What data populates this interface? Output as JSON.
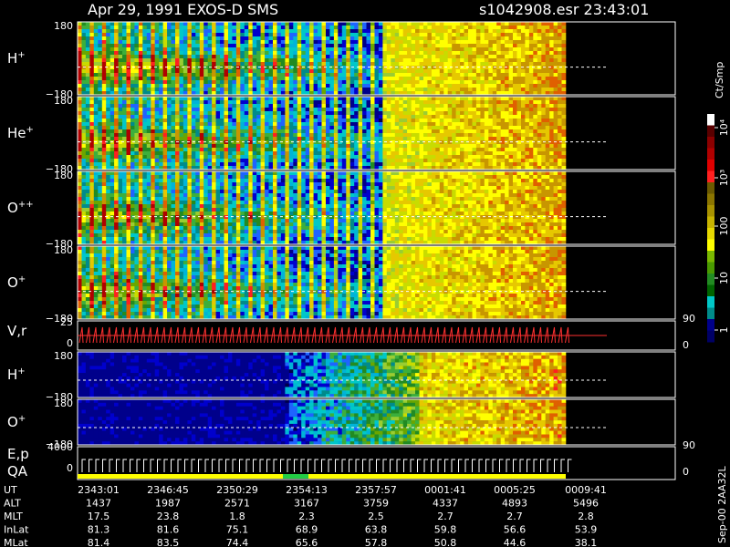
{
  "header": {
    "title_left": "Apr 29, 1991    EXOS-D SMS",
    "title_right": "s1042908.esr  23:43:01"
  },
  "panels": [
    {
      "label": "H",
      "sup": "+",
      "ymax": "180",
      "ymin": "−180",
      "hot": 1.0
    },
    {
      "label": "He",
      "sup": "+",
      "ymax": "180",
      "ymin": "−180",
      "hot": 0.8
    },
    {
      "label": "O",
      "sup": "++",
      "ymax": "180",
      "ymin": "−180",
      "hot": 0.75
    },
    {
      "label": "O",
      "sup": "+",
      "ymax": "180",
      "ymin": "−180",
      "hot": 0.7
    }
  ],
  "vr_panel": {
    "label": "V,r",
    "ymax": "25",
    "ymin": "0",
    "right_top": "90",
    "right_bottom": "0"
  },
  "lower_panels": [
    {
      "label": "H",
      "sup": "+",
      "ymax": "180",
      "ymin": "−180"
    },
    {
      "label": "O",
      "sup": "+",
      "ymax": "180",
      "ymin": "−180"
    }
  ],
  "ep_panel": {
    "label1": "E,p",
    "label2": "QA",
    "ymax": "4000",
    "ymin": "0",
    "right_top": "90",
    "right_bottom": "0"
  },
  "colorbar": {
    "unit": "Ct/Smp",
    "ticks": [
      "10⁴",
      "10³",
      "100",
      "10",
      "1"
    ],
    "colors": [
      "#ffffff",
      "#5a0000",
      "#8b0000",
      "#b00000",
      "#e00000",
      "#ff2020",
      "#6b5a00",
      "#8b7500",
      "#a89200",
      "#c8b400",
      "#e6d800",
      "#ffff00",
      "#7ab800",
      "#4a9a00",
      "#228b22",
      "#006400",
      "#00c8c8",
      "#008b8b",
      "#00008b",
      "#000066"
    ]
  },
  "footer": {
    "side_text": "Sep-00  2AA32L",
    "rows": [
      {
        "label": "UT",
        "values": [
          "2343:01",
          "2346:45",
          "2350:29",
          "2354:13",
          "2357:57",
          "0001:41",
          "0005:25",
          "0009:41"
        ]
      },
      {
        "label": "ALT",
        "values": [
          "1437",
          "1987",
          "2571",
          "3167",
          "3759",
          "4337",
          "4893",
          "5496"
        ]
      },
      {
        "label": "MLT",
        "values": [
          "17.5",
          "23.8",
          "1.8",
          "2.3",
          "2.5",
          "2.7",
          "2.7",
          "2.8"
        ]
      },
      {
        "label": "InLat",
        "values": [
          "81.3",
          "81.6",
          "75.1",
          "68.9",
          "63.8",
          "59.8",
          "56.6",
          "53.9"
        ]
      },
      {
        "label": "MLat",
        "values": [
          "81.4",
          "83.5",
          "74.4",
          "65.6",
          "57.8",
          "50.8",
          "44.6",
          "38.1"
        ]
      }
    ]
  },
  "chart_data": {
    "type": "heatmap",
    "title": "Apr 29, 1991    EXOS-D SMS",
    "x_ticks": [
      "2343:01",
      "2346:45",
      "2350:29",
      "2354:13",
      "2357:57",
      "0001:41",
      "0005:25",
      "0009:41"
    ],
    "panels": [
      "H+",
      "He+",
      "O++",
      "O+",
      "V,r",
      "H+",
      "O+",
      "E,p QA"
    ],
    "ylim": [
      -180,
      180
    ],
    "colorbar_unit": "Ct/Smp",
    "colorbar_ticks": [
      "1",
      "10",
      "100",
      "10^3",
      "10^4"
    ]
  }
}
